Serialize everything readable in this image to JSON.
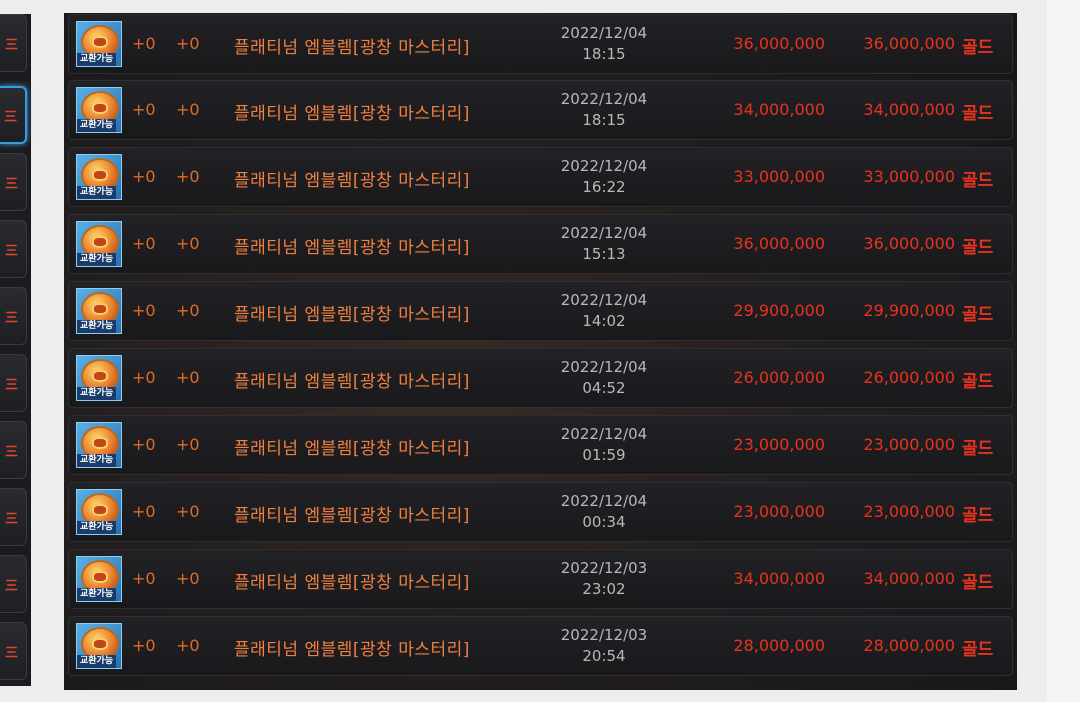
{
  "left_tabs": [
    "三",
    "三",
    "三",
    "三",
    "三",
    "三",
    "三",
    "三",
    "三",
    "三"
  ],
  "rows": [
    {
      "icon_badge": "교환가능",
      "enhance": "+0",
      "refine": "+0",
      "name": "플래티넘 엠블렘[광창 마스터리]",
      "date": "2022/12/04",
      "time": "18:15",
      "unit_price": "36,000,000",
      "total_price": "36,000,000",
      "currency": "골드"
    },
    {
      "icon_badge": "교환가능",
      "enhance": "+0",
      "refine": "+0",
      "name": "플래티넘 엠블렘[광창 마스터리]",
      "date": "2022/12/04",
      "time": "18:15",
      "unit_price": "34,000,000",
      "total_price": "34,000,000",
      "currency": "골드"
    },
    {
      "icon_badge": "교환가능",
      "enhance": "+0",
      "refine": "+0",
      "name": "플래티넘 엠블렘[광창 마스터리]",
      "date": "2022/12/04",
      "time": "16:22",
      "unit_price": "33,000,000",
      "total_price": "33,000,000",
      "currency": "골드"
    },
    {
      "icon_badge": "교환가능",
      "enhance": "+0",
      "refine": "+0",
      "name": "플래티넘 엠블렘[광창 마스터리]",
      "date": "2022/12/04",
      "time": "15:13",
      "unit_price": "36,000,000",
      "total_price": "36,000,000",
      "currency": "골드"
    },
    {
      "icon_badge": "교환가능",
      "enhance": "+0",
      "refine": "+0",
      "name": "플래티넘 엠블렘[광창 마스터리]",
      "date": "2022/12/04",
      "time": "14:02",
      "unit_price": "29,900,000",
      "total_price": "29,900,000",
      "currency": "골드"
    },
    {
      "icon_badge": "교환가능",
      "enhance": "+0",
      "refine": "+0",
      "name": "플래티넘 엠블렘[광창 마스터리]",
      "date": "2022/12/04",
      "time": "04:52",
      "unit_price": "26,000,000",
      "total_price": "26,000,000",
      "currency": "골드"
    },
    {
      "icon_badge": "교환가능",
      "enhance": "+0",
      "refine": "+0",
      "name": "플래티넘 엠블렘[광창 마스터리]",
      "date": "2022/12/04",
      "time": "01:59",
      "unit_price": "23,000,000",
      "total_price": "23,000,000",
      "currency": "골드"
    },
    {
      "icon_badge": "교환가능",
      "enhance": "+0",
      "refine": "+0",
      "name": "플래티넘 엠블렘[광창 마스터리]",
      "date": "2022/12/04",
      "time": "00:34",
      "unit_price": "23,000,000",
      "total_price": "23,000,000",
      "currency": "골드"
    },
    {
      "icon_badge": "교환가능",
      "enhance": "+0",
      "refine": "+0",
      "name": "플래티넘 엠블렘[광창 마스터리]",
      "date": "2022/12/03",
      "time": "23:02",
      "unit_price": "34,000,000",
      "total_price": "34,000,000",
      "currency": "골드"
    },
    {
      "icon_badge": "교환가능",
      "enhance": "+0",
      "refine": "+0",
      "name": "플래티넘 엠블렘[광창 마스터리]",
      "date": "2022/12/03",
      "time": "20:54",
      "unit_price": "28,000,000",
      "total_price": "28,000,000",
      "currency": "골드"
    }
  ]
}
